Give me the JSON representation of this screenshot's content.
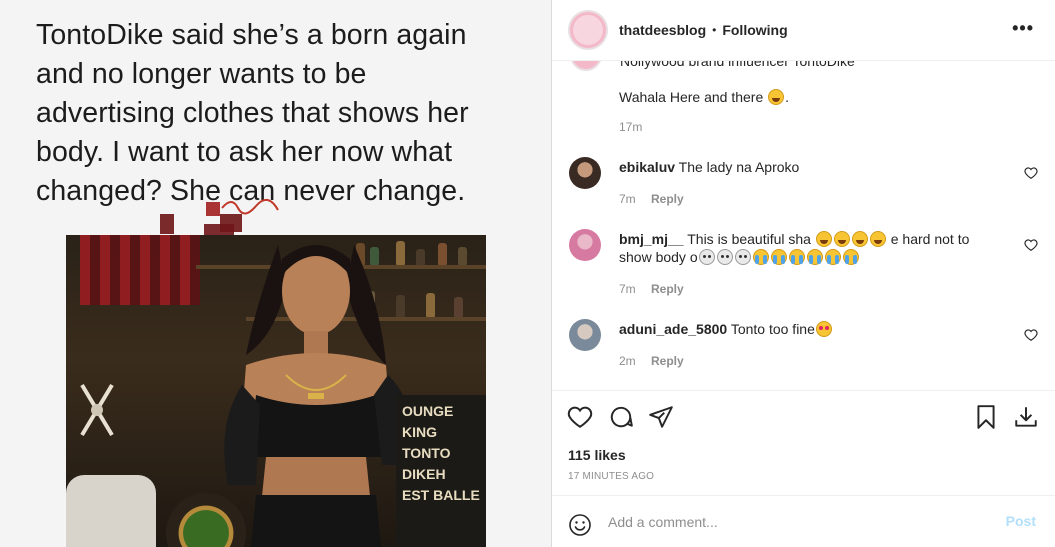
{
  "post_image": {
    "caption_text": "TontoDike said she’s a born again and no longer wants to be advertising clothes that shows her body. I want to ask her now what changed? She can never change.",
    "sign_lines": [
      "OUNGE",
      "KING",
      "TONTO",
      "DIKEH",
      "EST BALLE"
    ]
  },
  "header": {
    "username": "thatdeesblog",
    "separator": "•",
    "follow_status": "Following",
    "more_label": "•••"
  },
  "comments": {
    "cut_off_text": "Nollywood brand influencer TontoDike",
    "first": {
      "text": "Wahala Here and there",
      "time": "17m"
    },
    "items": [
      {
        "username": "ebikaluv",
        "text": "The lady na Aproko",
        "time": "7m",
        "reply": "Reply"
      },
      {
        "username": "bmj_mj__",
        "text": "This is beautiful sha",
        "text2": "e hard not to show",
        "text3": "body o",
        "time": "7m",
        "reply": "Reply"
      },
      {
        "username": "aduni_ade_5800",
        "text": "Tonto too fine",
        "time": "2m",
        "reply": "Reply"
      }
    ]
  },
  "actions": {
    "likes": "115 likes",
    "time_ago": "17 MINUTES AGO"
  },
  "comment_bar": {
    "placeholder": "Add a comment...",
    "post_label": "Post"
  },
  "colors": {
    "text": "#262626",
    "muted": "#8e8e8e",
    "post_disabled": "#b2dffc",
    "border": "#dbdbdb"
  }
}
